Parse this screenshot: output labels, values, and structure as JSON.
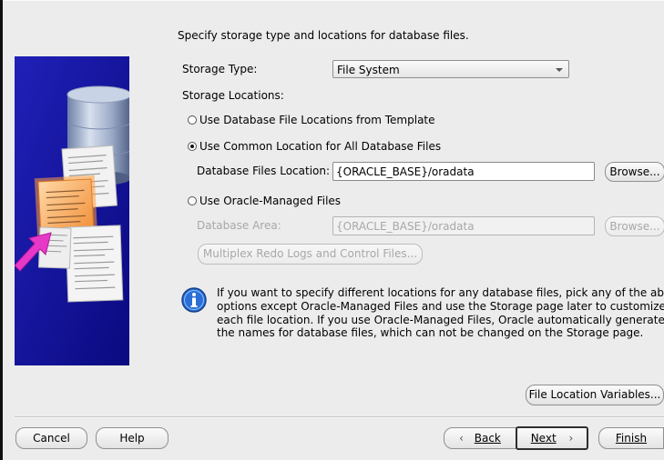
{
  "header": {
    "instruction": "Specify storage type and locations for database files."
  },
  "storage_type": {
    "label": "Storage Type:",
    "selected": "File System"
  },
  "storage_locations": {
    "label": "Storage Locations:",
    "options": [
      {
        "label": "Use Database File Locations from Template",
        "checked": false
      },
      {
        "label": "Use Common Location for All Database Files",
        "checked": true
      },
      {
        "label": "Use Oracle-Managed Files",
        "checked": false
      }
    ]
  },
  "common_location": {
    "label": "Database Files Location:",
    "value": "{ORACLE_BASE}/oradata",
    "browse_label": "Browse..."
  },
  "omf": {
    "area_label": "Database Area:",
    "area_value": "{ORACLE_BASE}/oradata",
    "browse_label": "Browse...",
    "multiplex_label": "Multiplex Redo Logs and Control Files..."
  },
  "info": {
    "lines": [
      "If you want to specify different locations for any database files, pick any of the above",
      "options except Oracle-Managed Files and use the Storage page later to customize",
      "each file location. If you use Oracle-Managed Files, Oracle automatically generates",
      "the names for database files, which can not be changed on the Storage page."
    ]
  },
  "file_location_variables_label": "File Location Variables...",
  "footer": {
    "cancel": "Cancel",
    "help": "Help",
    "back": "Back",
    "next": "Next",
    "finish": "Finish"
  },
  "colors": {
    "illustration_bg": "#1a1aa8",
    "arrow": "#e838c8",
    "info_icon": "#2a6fd6"
  }
}
